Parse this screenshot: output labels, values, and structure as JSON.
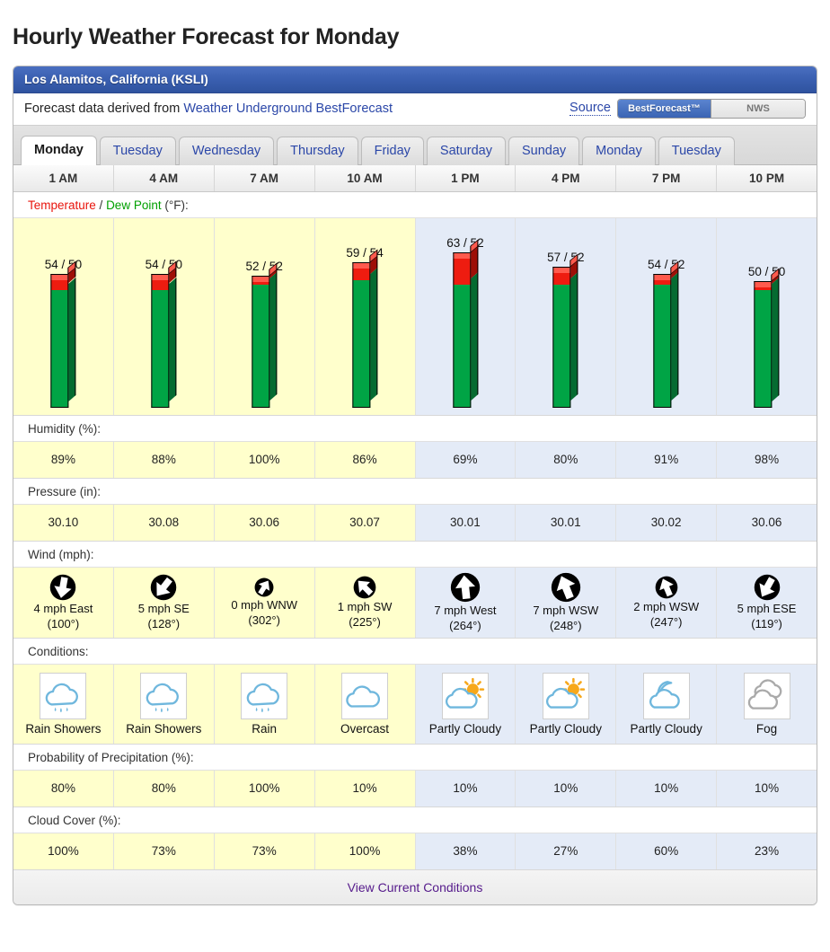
{
  "page": {
    "title": "Hourly Weather Forecast for Monday"
  },
  "header": {
    "location": "Los Alamitos, California (KSLI)"
  },
  "source": {
    "prefix": "Forecast data derived from ",
    "link": "Weather Underground BestForecast",
    "label": "Source",
    "options": [
      {
        "label": "BestForecast™",
        "active": true
      },
      {
        "label": "NWS",
        "active": false
      }
    ]
  },
  "tabs": [
    {
      "label": "Monday",
      "active": true
    },
    {
      "label": "Tuesday",
      "active": false
    },
    {
      "label": "Wednesday",
      "active": false
    },
    {
      "label": "Thursday",
      "active": false
    },
    {
      "label": "Friday",
      "active": false
    },
    {
      "label": "Saturday",
      "active": false
    },
    {
      "label": "Sunday",
      "active": false
    },
    {
      "label": "Monday",
      "active": false
    },
    {
      "label": "Tuesday",
      "active": false
    }
  ],
  "sections": {
    "temperature": {
      "temp_label": "Temperature",
      "sep": " / ",
      "dew_label": "Dew Point",
      "unit": " (°F):"
    },
    "humidity": "Humidity (%):",
    "pressure": "Pressure (in):",
    "wind": "Wind (mph):",
    "conditions": "Conditions:",
    "precip": "Probability of Precipitation (%):",
    "cloud": "Cloud Cover (%):"
  },
  "footer": {
    "link": "View Current Conditions"
  },
  "colors": {
    "header_blue": "#3a5fb0",
    "am_cell": "#ffffcc",
    "pm_cell": "#e4ebf7",
    "temp_red": "#ee1c10",
    "dew_green": "#00a445",
    "link_blue": "#2b47a8",
    "link_visited": "#551a8b"
  },
  "chart_data": {
    "type": "bar",
    "title": "Temperature / Dew Point (°F)",
    "xlabel": "",
    "ylabel": "°F",
    "ylim": [
      0,
      70
    ],
    "categories": [
      "1 AM",
      "4 AM",
      "7 AM",
      "10 AM",
      "1 PM",
      "4 PM",
      "7 PM",
      "10 PM"
    ],
    "series": [
      {
        "name": "Temperature",
        "color": "#ee1c10",
        "values": [
          54,
          54,
          52,
          59,
          63,
          57,
          54,
          50
        ]
      },
      {
        "name": "Dew Point",
        "color": "#00a445",
        "values": [
          50,
          50,
          52,
          54,
          52,
          52,
          52,
          50
        ]
      }
    ],
    "point_labels": [
      "54 / 50",
      "54 / 50",
      "52 / 52",
      "59 / 54",
      "63 / 52",
      "57 / 52",
      "54 / 52",
      "50 / 50"
    ],
    "grid": false,
    "legend": "inline-title"
  },
  "columns": [
    {
      "time": "1 AM",
      "period": "am",
      "temp": 54,
      "dew": 50,
      "temp_dew_label": "54 / 50",
      "humidity": "89%",
      "pressure": "30.10",
      "wind": {
        "speed": 4,
        "line1": "4 mph East",
        "line2": "(100°)",
        "deg": 100,
        "icon": "wind-arrow-icon"
      },
      "condition": {
        "text": "Rain Showers",
        "icon": "rain-showers-icon"
      },
      "precip": "80%",
      "cloud": "100%"
    },
    {
      "time": "4 AM",
      "period": "am",
      "temp": 54,
      "dew": 50,
      "temp_dew_label": "54 / 50",
      "humidity": "88%",
      "pressure": "30.08",
      "wind": {
        "speed": 5,
        "line1": "5 mph SE",
        "line2": "(128°)",
        "deg": 128,
        "icon": "wind-arrow-icon"
      },
      "condition": {
        "text": "Rain Showers",
        "icon": "rain-showers-icon"
      },
      "precip": "80%",
      "cloud": "73%"
    },
    {
      "time": "7 AM",
      "period": "am",
      "temp": 52,
      "dew": 52,
      "temp_dew_label": "52 / 52",
      "humidity": "100%",
      "pressure": "30.06",
      "wind": {
        "speed": 0,
        "line1": "0 mph WNW",
        "line2": "(302°)",
        "deg": 302,
        "icon": "wind-arrow-icon"
      },
      "condition": {
        "text": "Rain",
        "icon": "rain-icon"
      },
      "precip": "100%",
      "cloud": "73%"
    },
    {
      "time": "10 AM",
      "period": "am",
      "temp": 59,
      "dew": 54,
      "temp_dew_label": "59 / 54",
      "humidity": "86%",
      "pressure": "30.07",
      "wind": {
        "speed": 1,
        "line1": "1 mph SW",
        "line2": "(225°)",
        "deg": 225,
        "icon": "wind-arrow-icon"
      },
      "condition": {
        "text": "Overcast",
        "icon": "overcast-icon"
      },
      "precip": "10%",
      "cloud": "100%"
    },
    {
      "time": "1 PM",
      "period": "pm",
      "temp": 63,
      "dew": 52,
      "temp_dew_label": "63 / 52",
      "humidity": "69%",
      "pressure": "30.01",
      "wind": {
        "speed": 7,
        "line1": "7 mph West",
        "line2": "(264°)",
        "deg": 264,
        "icon": "wind-arrow-icon"
      },
      "condition": {
        "text": "Partly Cloudy",
        "icon": "partly-cloudy-day-icon"
      },
      "precip": "10%",
      "cloud": "38%"
    },
    {
      "time": "4 PM",
      "period": "pm",
      "temp": 57,
      "dew": 52,
      "temp_dew_label": "57 / 52",
      "humidity": "80%",
      "pressure": "30.01",
      "wind": {
        "speed": 7,
        "line1": "7 mph WSW",
        "line2": "(248°)",
        "deg": 248,
        "icon": "wind-arrow-icon"
      },
      "condition": {
        "text": "Partly Cloudy",
        "icon": "partly-cloudy-day-icon"
      },
      "precip": "10%",
      "cloud": "27%"
    },
    {
      "time": "7 PM",
      "period": "pm",
      "temp": 54,
      "dew": 52,
      "temp_dew_label": "54 / 52",
      "humidity": "91%",
      "pressure": "30.02",
      "wind": {
        "speed": 2,
        "line1": "2 mph WSW",
        "line2": "(247°)",
        "deg": 247,
        "icon": "wind-arrow-icon"
      },
      "condition": {
        "text": "Partly Cloudy",
        "icon": "partly-cloudy-night-icon"
      },
      "precip": "10%",
      "cloud": "60%"
    },
    {
      "time": "10 PM",
      "period": "pm",
      "temp": 50,
      "dew": 50,
      "temp_dew_label": "50 / 50",
      "humidity": "98%",
      "pressure": "30.06",
      "wind": {
        "speed": 5,
        "line1": "5 mph ESE",
        "line2": "(119°)",
        "deg": 119,
        "icon": "wind-arrow-icon"
      },
      "condition": {
        "text": "Fog",
        "icon": "fog-icon"
      },
      "precip": "10%",
      "cloud": "23%"
    }
  ]
}
